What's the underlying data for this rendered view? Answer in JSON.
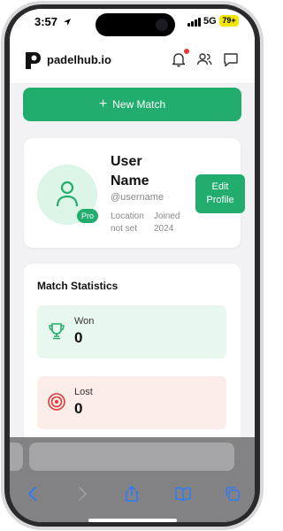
{
  "status_bar": {
    "time": "3:57",
    "network": "5G",
    "battery": "79+"
  },
  "header": {
    "brand": "padelhub.io"
  },
  "actions": {
    "new_match": "New Match"
  },
  "profile": {
    "name_line1": "User",
    "name_line2": "Name",
    "username": "@username",
    "badge": "Pro",
    "location_line1": "Location",
    "location_line2": "not set",
    "joined_line1": "Joined",
    "joined_line2": "2024",
    "edit_line1": "Edit",
    "edit_line2": "Profile"
  },
  "stats": {
    "title": "Match Statistics",
    "items": [
      {
        "label": "Won",
        "value": "0",
        "icon": "trophy-icon",
        "bg": "#e9f8ef",
        "icon_color": "#22ad6f"
      },
      {
        "label": "Lost",
        "value": "0",
        "icon": "target-icon",
        "bg": "#fcecea",
        "icon_color": "#e53935"
      }
    ]
  },
  "colors": {
    "accent": "#22ad6f",
    "notification": "#e53935"
  }
}
